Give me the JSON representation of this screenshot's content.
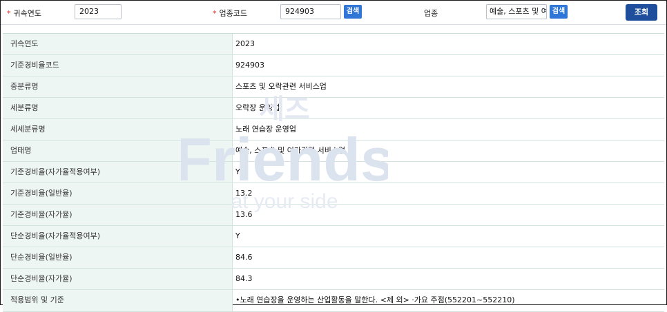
{
  "search": {
    "year_label": "귀속연도",
    "year_value": "2023",
    "code_label": "업종코드",
    "code_value": "924903",
    "code_search_label": "검색",
    "industry_label": "업종",
    "industry_value": "예술, 스포츠 및 여",
    "industry_search_label": "검색",
    "query_label": "조회"
  },
  "table": {
    "rows": [
      {
        "label": "귀속연도",
        "value": "2023"
      },
      {
        "label": "기준경비율코드",
        "value": "924903"
      },
      {
        "label": "중분류명",
        "value": "스포츠 및 오락관련 서비스업"
      },
      {
        "label": "세분류명",
        "value": "오락장 운영업"
      },
      {
        "label": "세세분류명",
        "value": "노래 연습장 운영업"
      },
      {
        "label": "업태명",
        "value": "예술, 스포츠 및 여가관련 서비스업"
      },
      {
        "label": "기준경비율(자가율적용여부)",
        "value": "Y"
      },
      {
        "label": "기준경비율(일반율)",
        "value": "13.2"
      },
      {
        "label": "기준경비율(자가율)",
        "value": "13.6"
      },
      {
        "label": "단순경비율(자가율적용여부)",
        "value": "Y"
      },
      {
        "label": "단순경비율(일반율)",
        "value": "84.6"
      },
      {
        "label": "단순경비율(자가율)",
        "value": "84.3"
      },
      {
        "label": "적용범위 및 기준",
        "value": "•노래 연습장을 운영하는 산업활동을 말한다. <제 외> ·가요 주점(552201~552210)"
      }
    ]
  },
  "watermark": {
    "line1": "세즈",
    "line2": "Friends",
    "line3": "at your side"
  }
}
